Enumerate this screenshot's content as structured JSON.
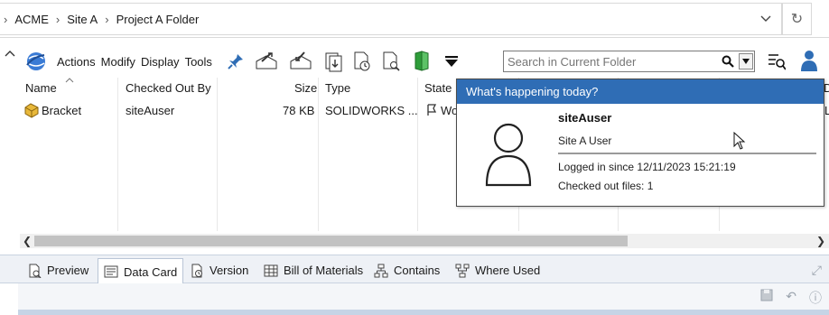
{
  "breadcrumb": {
    "items": [
      "ACME",
      "Site A",
      "Project A Folder"
    ]
  },
  "toolbar": {
    "menus": [
      "Actions",
      "Modify",
      "Display",
      "Tools"
    ],
    "search_placeholder": "Search in Current Folder"
  },
  "columns": {
    "name": "Name",
    "checked_out_by": "Checked Out By",
    "size": "Size",
    "type": "Type",
    "state": "State",
    "extra": "D"
  },
  "rows": [
    {
      "name": "Bracket",
      "checked_out_by": "siteAuser",
      "size": "78 KB",
      "type": "SOLIDWORKS ...",
      "state": "Wo",
      "extra": "L"
    }
  ],
  "tabs": [
    {
      "label": "Preview",
      "icon": "preview-icon"
    },
    {
      "label": "Data Card",
      "icon": "data-card-icon",
      "active": true
    },
    {
      "label": "Version",
      "icon": "version-icon"
    },
    {
      "label": "Bill of Materials",
      "icon": "bom-icon"
    },
    {
      "label": "Contains",
      "icon": "contains-icon"
    },
    {
      "label": "Where Used",
      "icon": "where-used-icon"
    }
  ],
  "popup": {
    "header": "What's happening today?",
    "username": "siteAuser",
    "role": "Site A User",
    "logged_in": "Logged in since 12/11/2023 15:21:19",
    "checked_out": "Checked out files: 1"
  },
  "colors": {
    "accent": "#2f6db5",
    "tab_bar": "#eef1f6",
    "scroll_thumb": "#c2c2c2"
  }
}
